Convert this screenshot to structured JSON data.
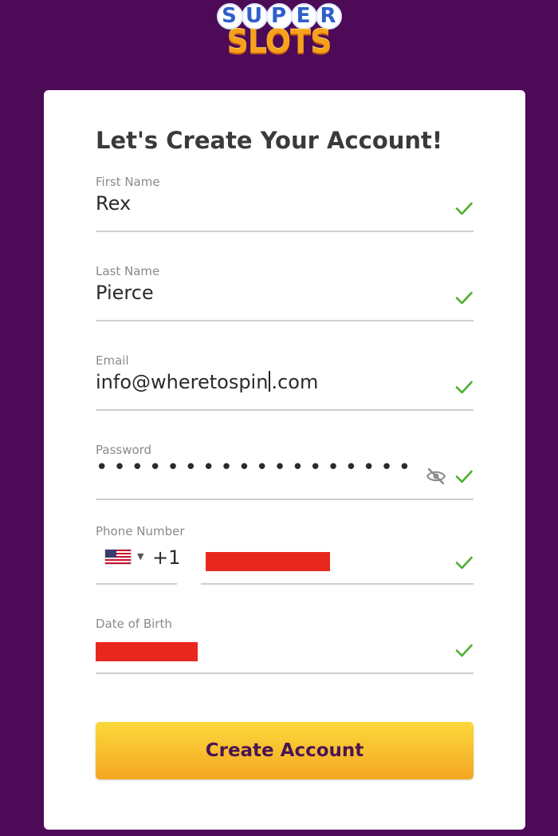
{
  "logo": {
    "super": [
      "S",
      "U",
      "P",
      "E",
      "R"
    ],
    "slots": "SLOTS"
  },
  "form": {
    "title": "Let's Create Your Account!",
    "first_name": {
      "label": "First Name",
      "value": "Rex",
      "valid": true
    },
    "last_name": {
      "label": "Last Name",
      "value": "Pierce",
      "valid": true
    },
    "email": {
      "label": "Email",
      "value_before_cursor": "info@wheretospin",
      "value_after_cursor": ".com",
      "valid": true
    },
    "password": {
      "label": "Password",
      "masked_value": "••••••••••••••••••",
      "visibility_icon": "eye-slash-icon",
      "valid": true
    },
    "phone": {
      "label": "Phone Number",
      "country": "US",
      "country_flag_icon": "us-flag-icon",
      "country_code": "+1",
      "number": "[redacted]",
      "valid": true
    },
    "dob": {
      "label": "Date of Birth",
      "value": "[redacted]",
      "valid": true
    },
    "submit_label": "Create Account"
  },
  "colors": {
    "background": "#4d0b57",
    "card": "#ffffff",
    "check": "#4caf30",
    "button_top": "#fbd93b",
    "button_bottom": "#f5a623",
    "button_text": "#4b1452",
    "redaction": "#e8281e"
  }
}
